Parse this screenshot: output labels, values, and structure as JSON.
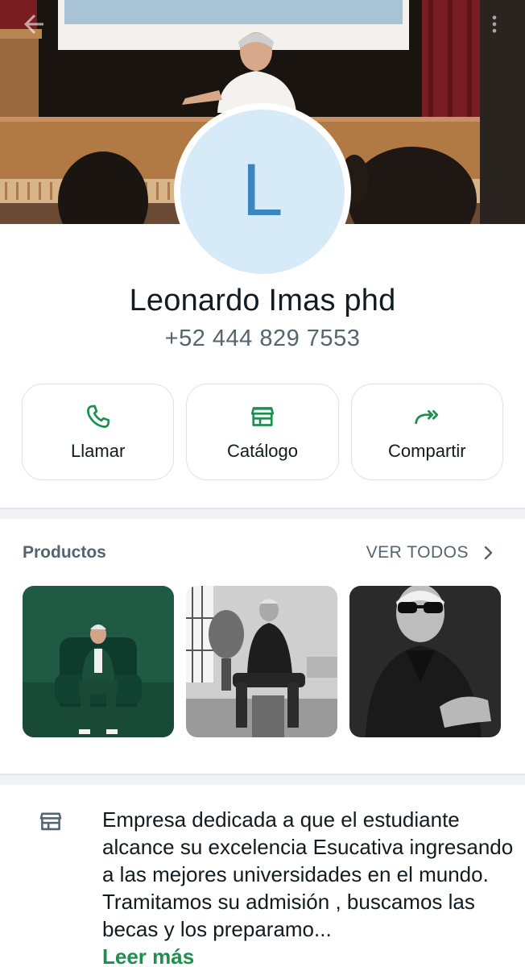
{
  "profile": {
    "avatar_letter": "L",
    "name": "Leonardo Imas phd",
    "phone": "+52 444 829 7553"
  },
  "actions": [
    {
      "label": "Llamar",
      "icon": "phone-icon"
    },
    {
      "label": "Catálogo",
      "icon": "storefront-icon"
    },
    {
      "label": "Compartir",
      "icon": "share-forward-icon"
    }
  ],
  "products": {
    "title": "Productos",
    "see_all": "VER TODOS",
    "items": [
      {
        "icon": "product-image"
      },
      {
        "icon": "product-image"
      },
      {
        "icon": "product-image"
      }
    ]
  },
  "about": {
    "icon": "storefront-icon",
    "description": "Empresa dedicada a que el estudiante alcance su excelencia Esucativa ingresando a las mejores universidades en el mundo. Tramitamos su admisión , buscamos las becas y los preparamo...",
    "read_more": "Leer más"
  },
  "colors": {
    "accent_green": "#1d8f4e",
    "avatar_bg": "#d6ebf7",
    "avatar_letter": "#3a87c0",
    "secondary_text": "#54656f"
  }
}
